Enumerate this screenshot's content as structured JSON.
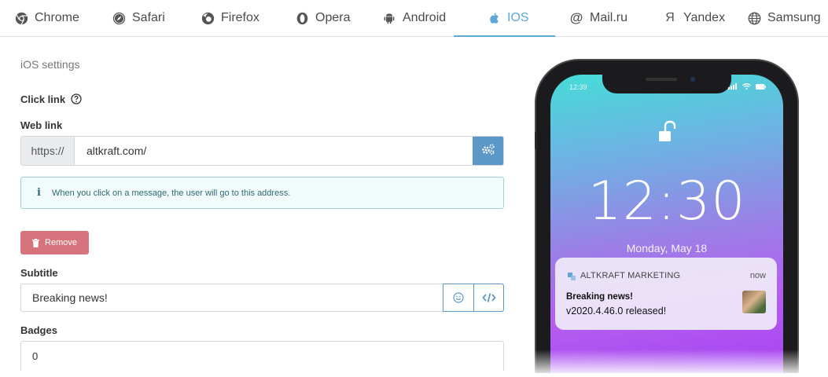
{
  "tabs": [
    {
      "label": "Chrome",
      "icon": "chrome-icon"
    },
    {
      "label": "Safari",
      "icon": "safari-icon"
    },
    {
      "label": "Firefox",
      "icon": "firefox-icon"
    },
    {
      "label": "Opera",
      "icon": "opera-icon"
    },
    {
      "label": "Android",
      "icon": "android-icon"
    },
    {
      "label": "IOS",
      "icon": "apple-icon",
      "active": true
    },
    {
      "label": "Mail.ru",
      "icon": "at-icon"
    },
    {
      "label": "Yandex",
      "icon": "yandex-icon"
    },
    {
      "label": "Samsung",
      "icon": "globe-icon"
    }
  ],
  "form": {
    "section_title": "iOS settings",
    "click_link_label": "Click link",
    "web_link_label": "Web link",
    "web_link_prefix": "https://",
    "web_link_value": "altkraft.com/",
    "info_text": "When you click on a message, the user will go to this address.",
    "remove_label": "Remove",
    "subtitle_label": "Subtitle",
    "subtitle_value": "Breaking news!",
    "badges_label": "Badges",
    "badges_value": "0"
  },
  "phone": {
    "status_time": "12:39",
    "clock": "12:30",
    "date": "Monday, May 18",
    "notification": {
      "app_name": "ALTKRAFT MARKETING",
      "time": "now",
      "title": "Breaking news!",
      "body": "v2020.4.46.0 released!"
    }
  },
  "colors": {
    "accent": "#5ea8d6",
    "button_blue": "#5b98c8",
    "remove_red": "#d6737c",
    "info_border": "#9fd2d6"
  }
}
